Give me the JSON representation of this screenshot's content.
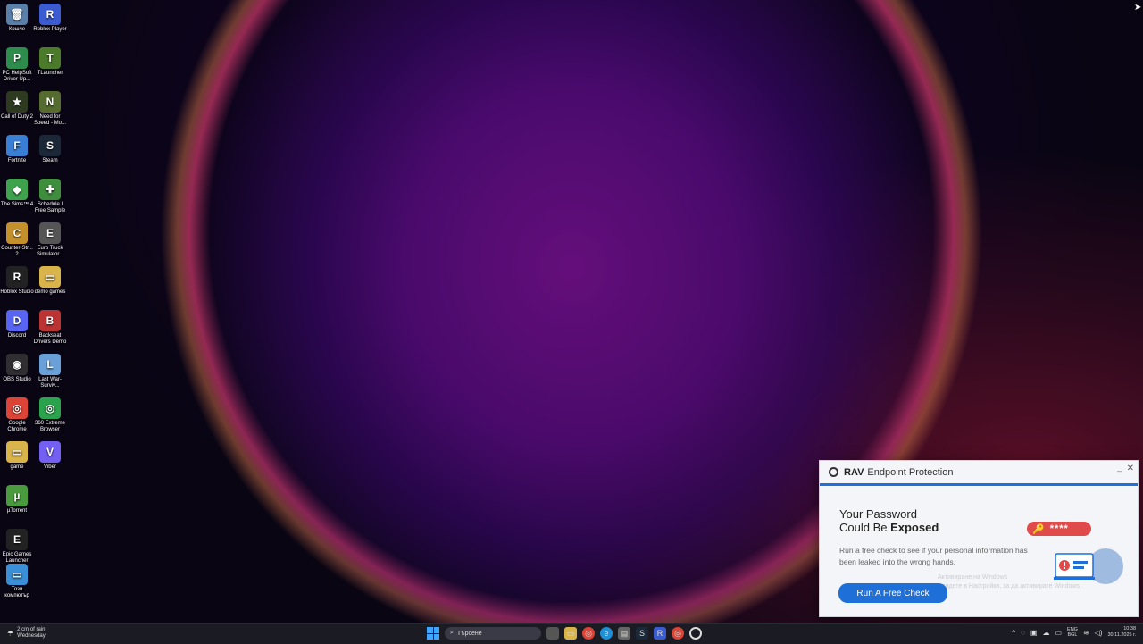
{
  "desktop": {
    "icons": [
      {
        "label": "Кошче",
        "glyph": "🗑",
        "color": "#5a7fa8"
      },
      {
        "label": "Roblox Player",
        "glyph": "R",
        "color": "#3b5bd1"
      },
      {
        "label": "PC HelpSoft Driver Up...",
        "glyph": "P",
        "color": "#2d8c4c"
      },
      {
        "label": "TLauncher",
        "glyph": "T",
        "color": "#4a7a2a"
      },
      {
        "label": "Call of Duty 2",
        "glyph": "★",
        "color": "#2e3a20"
      },
      {
        "label": "Need for Speed - Mo...",
        "glyph": "N",
        "color": "#556b2f"
      },
      {
        "label": "Fortnite",
        "glyph": "F",
        "color": "#3a7fd6"
      },
      {
        "label": "Steam",
        "glyph": "S",
        "color": "#1b2838"
      },
      {
        "label": "The Sims™ 4",
        "glyph": "◆",
        "color": "#3fa34d"
      },
      {
        "label": "Schedule I Free Sample",
        "glyph": "✚",
        "color": "#3e8e3e"
      },
      {
        "label": "Counter-Str... 2",
        "glyph": "C",
        "color": "#c4902c"
      },
      {
        "label": "Euro Truck Simulator...",
        "glyph": "E",
        "color": "#555"
      },
      {
        "label": "Roblox Studio",
        "glyph": "R",
        "color": "#222"
      },
      {
        "label": "demo games",
        "glyph": "▭",
        "color": "#d9b44a"
      },
      {
        "label": "Discord",
        "glyph": "D",
        "color": "#5865f2"
      },
      {
        "label": "Backseat Drivers Demo",
        "glyph": "B",
        "color": "#b33"
      },
      {
        "label": "OBS Studio",
        "glyph": "◉",
        "color": "#302e31"
      },
      {
        "label": "Last War-Surviv...",
        "glyph": "L",
        "color": "#6aa0d8"
      },
      {
        "label": "Google Chrome",
        "glyph": "◎",
        "color": "#db4437"
      },
      {
        "label": "360 Extreme Browser",
        "glyph": "◎",
        "color": "#2ba24c"
      },
      {
        "label": "game",
        "glyph": "▭",
        "color": "#d9b44a"
      },
      {
        "label": "Viber",
        "glyph": "V",
        "color": "#7360f2"
      },
      {
        "label": "µTorrent",
        "glyph": "µ",
        "color": "#4a9b3e"
      },
      {
        "label": "Epic Games Launcher",
        "glyph": "E",
        "color": "#222"
      },
      {
        "label": "Този компютър",
        "glyph": "▭",
        "color": "#3a8fd6"
      }
    ]
  },
  "popup": {
    "brand": "RAV",
    "product": "Endpoint Protection",
    "title_line1": "Your Password",
    "title_line2_prefix": "Could Be ",
    "title_line2_bold": "Exposed",
    "description": "Run a free check to see if your personal information has been leaked into the wrong hands.",
    "cta_label": "Run A Free Check",
    "masked_password": "****",
    "watermark_line1": "Активиране на Windows",
    "watermark_line2": "Отидете в Настройки, за да активирате Windows.",
    "accent_color": "#1e6fd8"
  },
  "taskbar": {
    "weather_line1": "2 cm of rain",
    "weather_line2": "Wednesday",
    "search_placeholder": "Търсене",
    "lang_line1": "ENG",
    "lang_line2": "BGL",
    "time": "10:38",
    "date": "30.11.2025 г."
  }
}
